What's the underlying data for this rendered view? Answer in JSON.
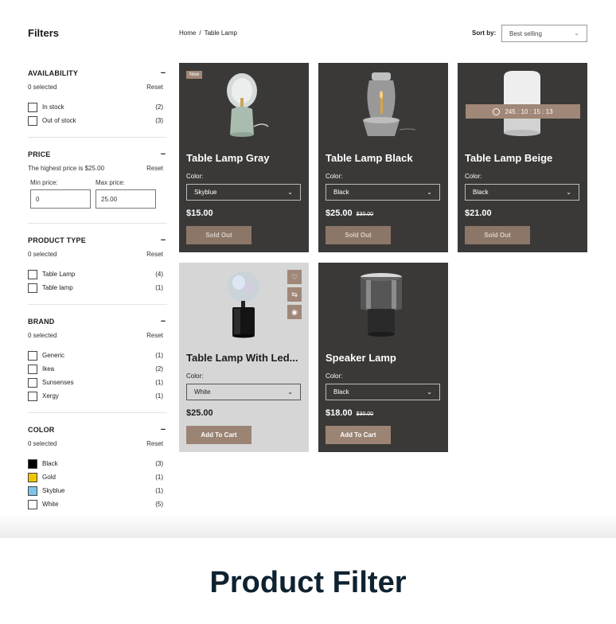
{
  "sidebar": {
    "title": "Filters",
    "availability": {
      "title": "AVAILABILITY",
      "selected": "0 selected",
      "reset": "Reset",
      "options": [
        {
          "label": "In stock",
          "count": "(2)"
        },
        {
          "label": "Out of stock",
          "count": "(3)"
        }
      ]
    },
    "price": {
      "title": "PRICE",
      "highest": "The highest price is $25.00",
      "reset": "Reset",
      "min_label": "Min price:",
      "min_value": "0",
      "max_label": "Max price:",
      "max_value": "25.00"
    },
    "product_type": {
      "title": "PRODUCT TYPE",
      "selected": "0 selected",
      "reset": "Reset",
      "options": [
        {
          "label": "Table Lamp",
          "count": "(4)"
        },
        {
          "label": "Table lamp",
          "count": "(1)"
        }
      ]
    },
    "brand": {
      "title": "BRAND",
      "selected": "0 selected",
      "reset": "Reset",
      "options": [
        {
          "label": "Generic",
          "count": "(1)"
        },
        {
          "label": "Ikea",
          "count": "(2)"
        },
        {
          "label": "Sunsenses",
          "count": "(1)"
        },
        {
          "label": "Xergy",
          "count": "(1)"
        }
      ]
    },
    "color": {
      "title": "COLOR",
      "selected": "0 selected",
      "reset": "Reset",
      "options": [
        {
          "label": "Black",
          "count": "(3)",
          "swatch": "#000000"
        },
        {
          "label": "Gold",
          "count": "(1)",
          "swatch": "#f2c500"
        },
        {
          "label": "Skyblue",
          "count": "(1)",
          "swatch": "#7ec4e8"
        },
        {
          "label": "White",
          "count": "(5)",
          "swatch": "#ffffff"
        }
      ]
    }
  },
  "breadcrumb": {
    "home": "Home",
    "separator": "/",
    "current": "Table Lamp"
  },
  "sort": {
    "label": "Sort by:",
    "value": "Best selling"
  },
  "products": [
    {
      "name": "Table Lamp Gray",
      "badge": "New",
      "color_label": "Color:",
      "variant": "Skyblue",
      "price": "$15.00",
      "button": "Sold Out"
    },
    {
      "name": "Table Lamp Black",
      "color_label": "Color:",
      "variant": "Black",
      "price": "$25.00",
      "old_price": "$30.00",
      "button": "Sold Out"
    },
    {
      "name": "Table Lamp Beige",
      "timer": "245 : 10 : 15 : 13",
      "color_label": "Color:",
      "variant": "Black",
      "price": "$21.00",
      "button": "Sold Out"
    },
    {
      "name": "Table Lamp With Led...",
      "color_label": "Color:",
      "variant": "White",
      "price": "$25.00",
      "button": "Add To Cart"
    },
    {
      "name": "Speaker Lamp",
      "color_label": "Color:",
      "variant": "Black",
      "price": "$18.00",
      "old_price": "$30.00",
      "button": "Add To Cart"
    }
  ],
  "icons": {
    "wishlist": "heart-icon",
    "compare": "swap-icon",
    "quickview": "eye-icon",
    "timer": "stopwatch-icon",
    "chevron": "chevron-down-icon"
  },
  "banner": {
    "title": "Product Filter"
  },
  "colors": {
    "card_dark": "#3a3938",
    "card_light": "#d6d6d6",
    "accent": "#a08777",
    "button": "#8c7668",
    "banner_text": "#0f2230"
  }
}
